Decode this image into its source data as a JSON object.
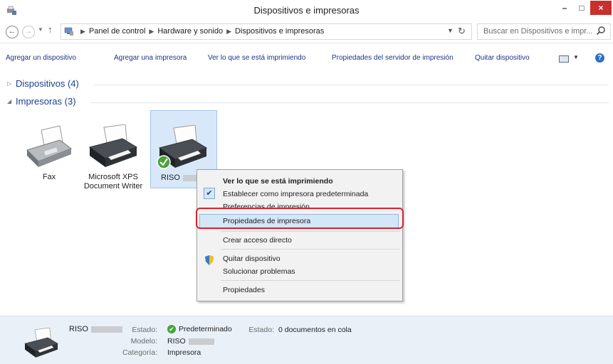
{
  "window": {
    "title": "Dispositivos e impresoras",
    "minimize": "–",
    "maximize": "□",
    "close": "×"
  },
  "address": {
    "breadcrumbs": [
      "Panel de control",
      "Hardware y sonido",
      "Dispositivos e impresoras"
    ],
    "search_placeholder": "Buscar en Dispositivos e impr..."
  },
  "toolbar": {
    "add_device": "Agregar un dispositivo",
    "add_printer": "Agregar una impresora",
    "see_printing": "Ver lo que se está imprimiendo",
    "server_props": "Propiedades del servidor de impresión",
    "remove_device": "Quitar dispositivo",
    "help": "?"
  },
  "groups": {
    "devices": "Dispositivos (4)",
    "printers": "Impresoras (3)"
  },
  "printers": [
    {
      "label": "Fax"
    },
    {
      "label": "Microsoft XPS Document Writer"
    },
    {
      "label": "RISO"
    }
  ],
  "context_menu": {
    "items": [
      "Ver lo que se está imprimiendo",
      "Establecer como impresora predeterminada",
      "Preferencias de impresión",
      "Propiedades de impresora",
      "Crear acceso directo",
      "Quitar dispositivo",
      "Solucionar problemas",
      "Propiedades"
    ]
  },
  "details": {
    "name": "RISO",
    "state_label": "Estado:",
    "state_value": "Predeterminado",
    "state2_label": "Estado:",
    "state2_value": "0 documentos en cola",
    "model_label": "Modelo:",
    "model_value": "RISO",
    "category_label": "Categoría:",
    "category_value": "Impresora"
  },
  "colors": {
    "highlight_box": "#d8222d",
    "selection": "#d8e8f8",
    "details_bg": "#eaf0f8",
    "link": "#1e3287"
  }
}
